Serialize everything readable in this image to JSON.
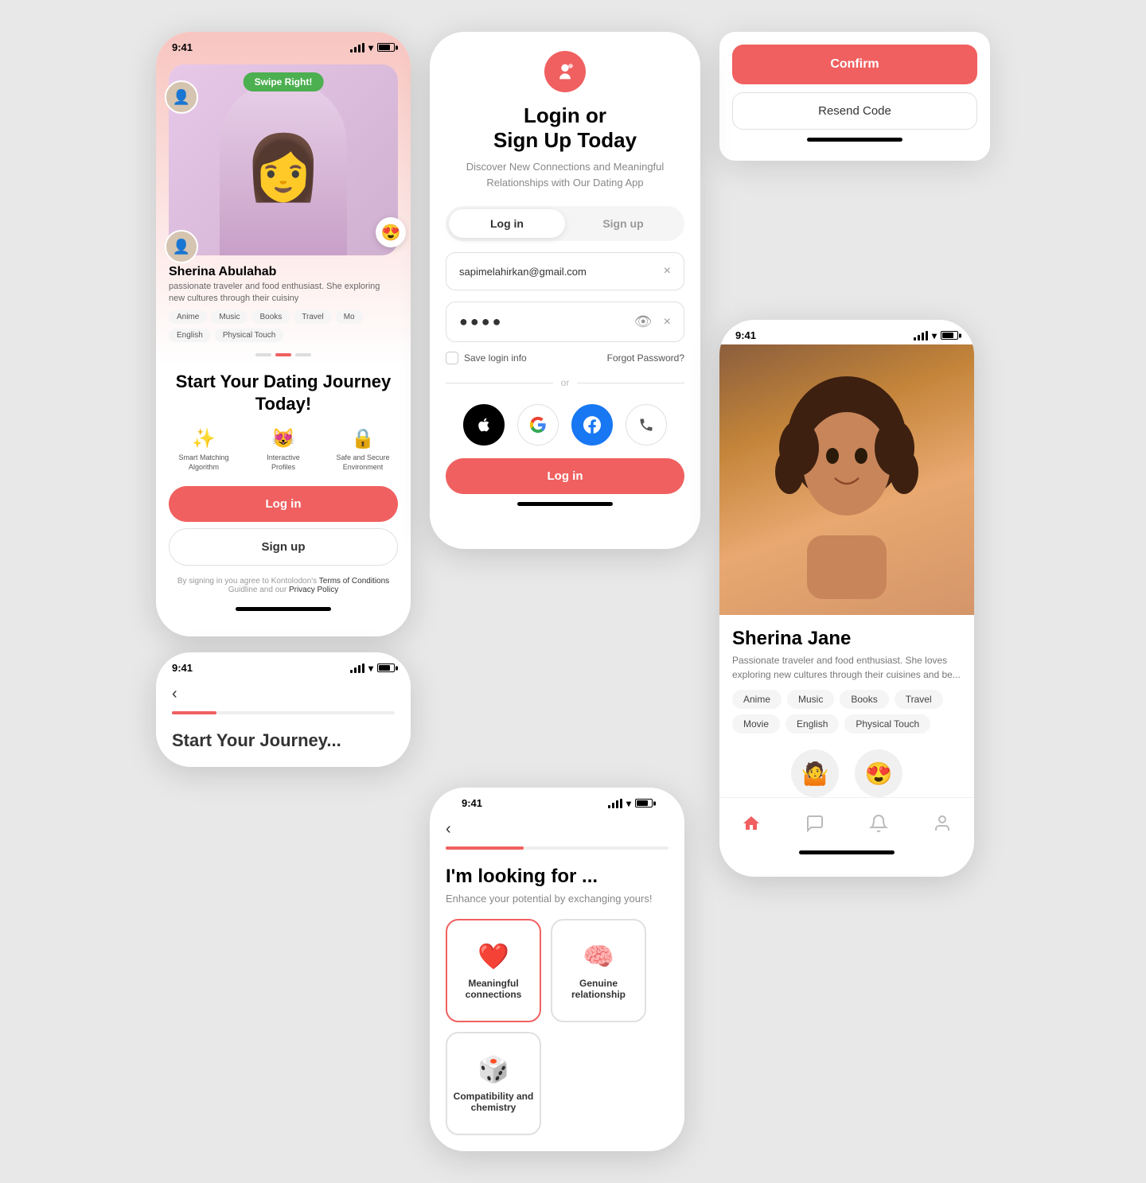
{
  "app": {
    "name": "Dating App",
    "icon": "👤",
    "accent_color": "#f06060"
  },
  "phone1": {
    "status_time": "9:41",
    "swipe_badge": "Swipe Right!",
    "profile_name": "Sherina Abulahab",
    "profile_bio": "passionate traveler and food enthusiast. She exploring new cultures through their cuisiny",
    "tags": [
      "Anime",
      "Music",
      "Books",
      "Travel",
      "Mo"
    ],
    "language_tags": [
      "English",
      "Physical Touch"
    ],
    "onboard_title": "Start Your Dating Journey Today!",
    "features": [
      {
        "icon": "✨",
        "label": "Smart Matching Algorithm"
      },
      {
        "icon": "😻",
        "label": "Interactive Profiles"
      },
      {
        "icon": "🔒",
        "label": "Safe and Secure Environment"
      }
    ],
    "login_btn": "Log in",
    "signup_btn": "Sign up",
    "terms_text": "By signing in you agree to Kontolodon's",
    "terms_link": "Terms of Conditions",
    "guide_text": "Guidline and our",
    "privacy_link": "Privacy Policy"
  },
  "phone2": {
    "status_time": "9:41",
    "title_line1": "Login or",
    "title_line2": "Sign Up Today",
    "subtitle": "Discover New Connections and Meaningful Relationships with Our Dating App",
    "tab_login": "Log in",
    "tab_signup": "Sign up",
    "email_value": "sapimelahirkan@gmail.com",
    "password_dots": "●●●●",
    "save_login": "Save login info",
    "forgot_password": "Forgot Password?",
    "or_text": "or",
    "login_btn": "Log in"
  },
  "phone3": {
    "status_time": "9:41",
    "progress": 35,
    "title": "I'm looking for ...",
    "subtitle": "Enhance your potential by exchanging yours!",
    "options": [
      {
        "icon": "❤️",
        "label": "Meaningful connections"
      },
      {
        "icon": "🧠",
        "label": "Genuine relationship"
      },
      {
        "icon": "🎲",
        "label": "Compatibility and chemistry"
      }
    ]
  },
  "confirm_panel": {
    "confirm_btn": "Confirm",
    "resend_btn": "Resend Code"
  },
  "phone5": {
    "status_time": "9:41",
    "profile_name": "Sherina Jane",
    "profile_bio": "Passionate traveler and food enthusiast. She loves exploring new cultures through their cuisines and be...",
    "tags": [
      "Anime",
      "Music",
      "Books",
      "Travel",
      "Movie",
      "English",
      "Physical Touch"
    ],
    "nav_items": [
      "home",
      "chat",
      "bell",
      "user"
    ]
  }
}
